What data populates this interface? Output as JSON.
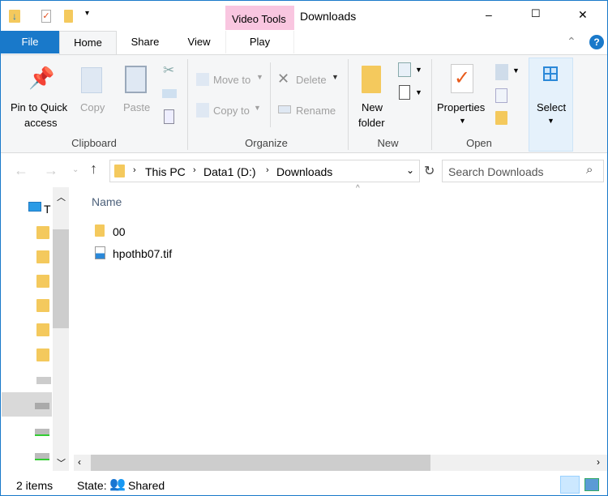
{
  "title": "Downloads",
  "context_tab": "Video Tools",
  "tabs": [
    {
      "label": "File"
    },
    {
      "label": "Home"
    },
    {
      "label": "Share"
    },
    {
      "label": "View"
    },
    {
      "label": "Play"
    }
  ],
  "window_controls": {
    "minimize": "–",
    "maximize": "☐",
    "close": "✕"
  },
  "ribbon": {
    "clipboard": {
      "pin": "Pin to Quick",
      "pin2": "access",
      "copy": "Copy",
      "paste": "Paste",
      "group": "Clipboard"
    },
    "organize": {
      "move_to": "Move to",
      "copy_to": "Copy to",
      "delete": "Delete",
      "rename": "Rename",
      "group": "Organize"
    },
    "new": {
      "new_folder": "New",
      "new_folder2": "folder",
      "group": "New"
    },
    "open": {
      "properties": "Properties",
      "group": "Open"
    },
    "select": {
      "label": "Select"
    }
  },
  "address": {
    "crumbs": [
      "This PC",
      "Data1 (D:)",
      "Downloads"
    ],
    "search_placeholder": "Search Downloads"
  },
  "list": {
    "column": "Name",
    "items": [
      {
        "name": "00",
        "type": "folder"
      },
      {
        "name": "hpothb07.tif",
        "type": "image"
      }
    ]
  },
  "nav": {
    "first_label": "T"
  },
  "status": {
    "count": "2 items",
    "state_label": "State:",
    "state_value": "Shared"
  },
  "colors": {
    "accent": "#1979ca",
    "context": "#f9c6e0",
    "select_bg": "#e5f1fb"
  }
}
